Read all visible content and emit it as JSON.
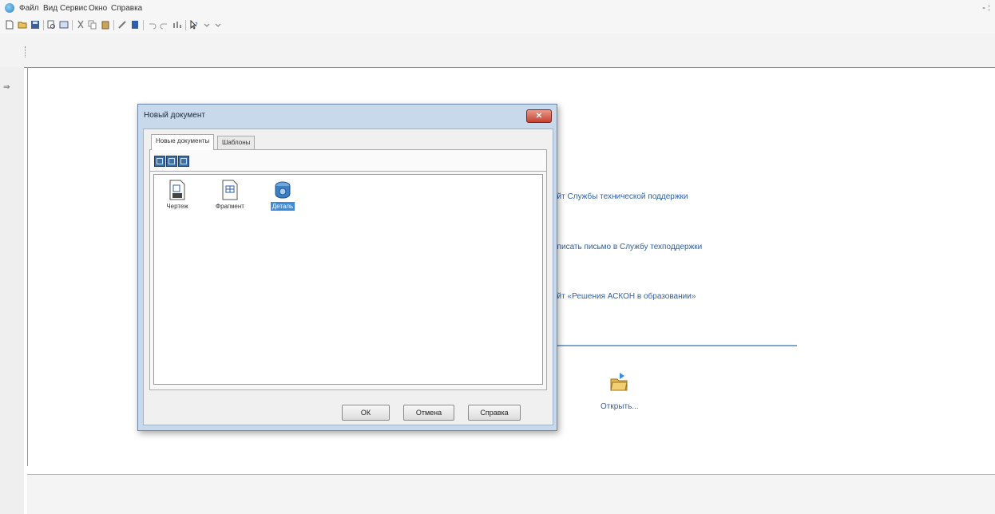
{
  "menu": {
    "items": [
      "Файл",
      "Вид",
      "Сервис",
      "Окно",
      "Справка"
    ]
  },
  "window_controls": "- :",
  "start_page": {
    "links": [
      "айт Службы технической поддержки",
      "аписать письмо в Службу техподдержки",
      "айт «Решения АСКОН в образовании»"
    ],
    "open_label": "Открыть..."
  },
  "dialog": {
    "title": "Новый документ",
    "close_label": "✕",
    "tabs": [
      "Новые документы",
      "Шаблоны"
    ],
    "active_tab": "Новые документы",
    "documents": [
      {
        "label": "Чертеж",
        "icon": "drawing-icon",
        "selected": false
      },
      {
        "label": "Фрагмент",
        "icon": "fragment-icon",
        "selected": false
      },
      {
        "label": "Деталь",
        "icon": "part-icon",
        "selected": true
      }
    ],
    "buttons": {
      "ok": "ОК",
      "cancel": "Отмена",
      "help": "Справка"
    }
  },
  "colors": {
    "link": "#2f5fa4",
    "selection": "#3b8cdf",
    "dialog_frame": "#c9d9ec",
    "close_button": "#c4412e"
  }
}
